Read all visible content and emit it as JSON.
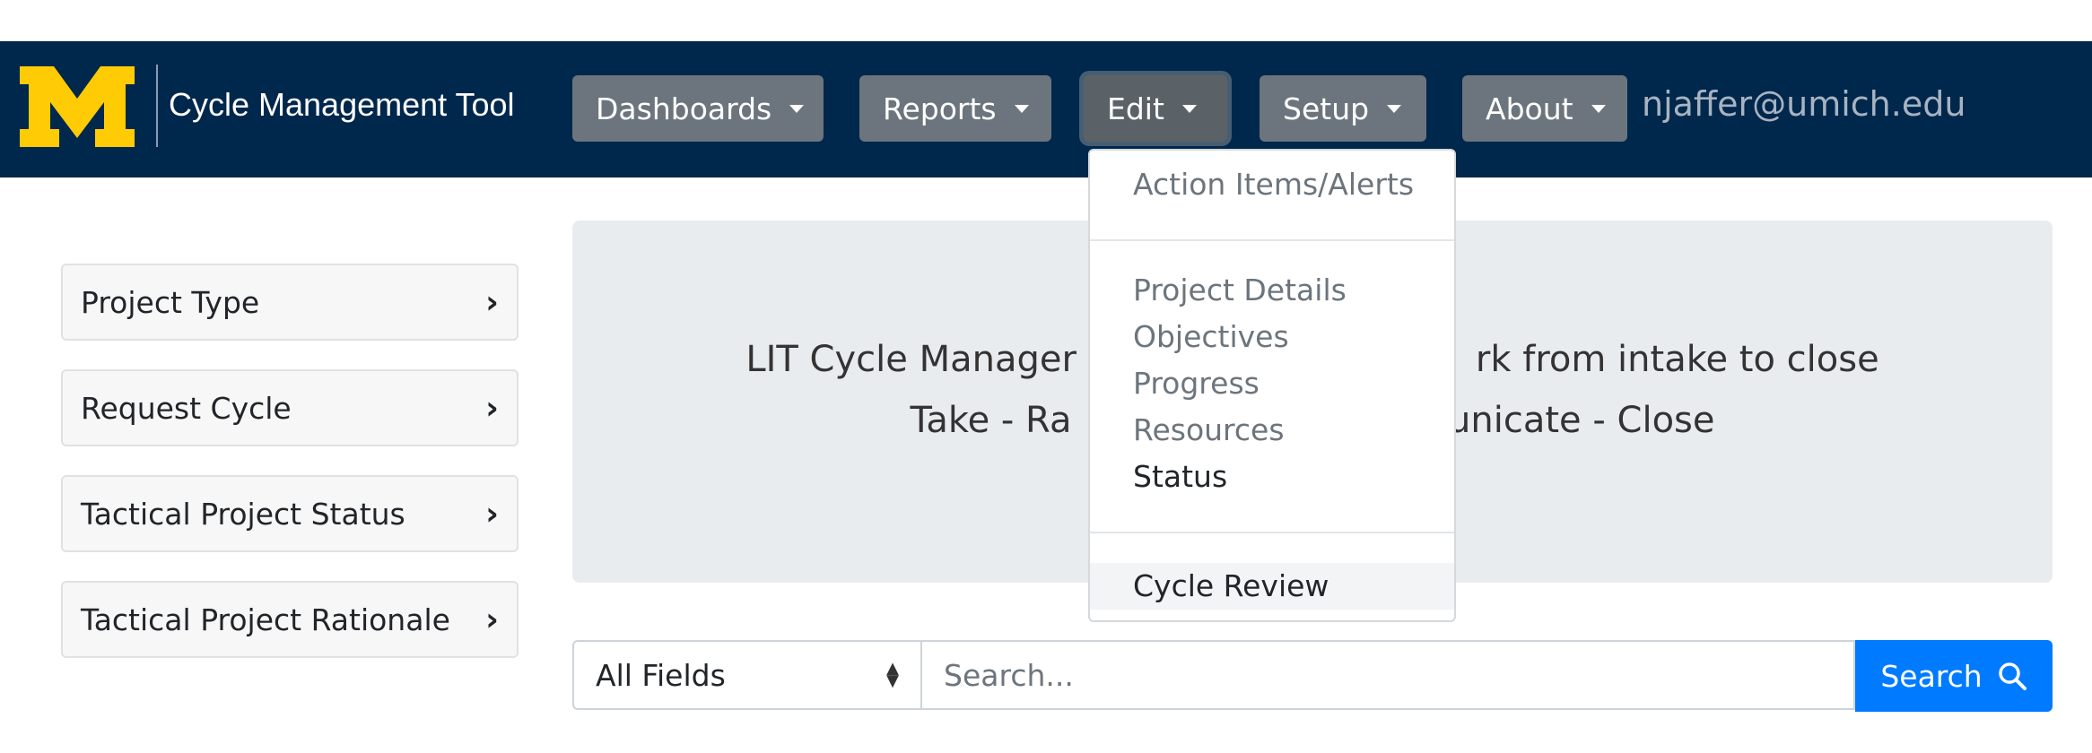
{
  "header": {
    "brand_title": "Cycle Management Tool",
    "logo_letter": "M",
    "user_email": "njaffer@umich.edu",
    "nav": [
      {
        "label": "Dashboards"
      },
      {
        "label": "Reports"
      },
      {
        "label": "Edit",
        "active": true
      },
      {
        "label": "Setup"
      },
      {
        "label": "About"
      }
    ]
  },
  "sidebar": {
    "items": [
      {
        "label": "Project Type"
      },
      {
        "label": "Request Cycle"
      },
      {
        "label": "Tactical Project Status"
      },
      {
        "label": "Tactical Project Rationale"
      }
    ]
  },
  "jumbotron": {
    "line1": "LIT Cycle Manager                                   rk from intake to close",
    "line2": "Take - Ra                                 unicate - Close"
  },
  "search": {
    "field_select": "All Fields",
    "placeholder": "Search...",
    "button_label": "Search"
  },
  "edit_menu": {
    "items": [
      {
        "label": "Action Items/Alerts"
      },
      {
        "label": "Project Details"
      },
      {
        "label": "Objectives"
      },
      {
        "label": "Progress"
      },
      {
        "label": "Resources"
      },
      {
        "label": "Status"
      },
      {
        "label": "Cycle Review"
      }
    ]
  },
  "colors": {
    "navbar": "#00274c",
    "logo_maize": "#ffcb05",
    "nav_button": "#6c757d",
    "jumbotron": "#e9ecef",
    "primary": "#007bff"
  },
  "icons": {
    "chevron": "chevron-right-icon",
    "search": "search-icon",
    "caret": "caret-down-icon",
    "select": "select-arrows-icon"
  }
}
